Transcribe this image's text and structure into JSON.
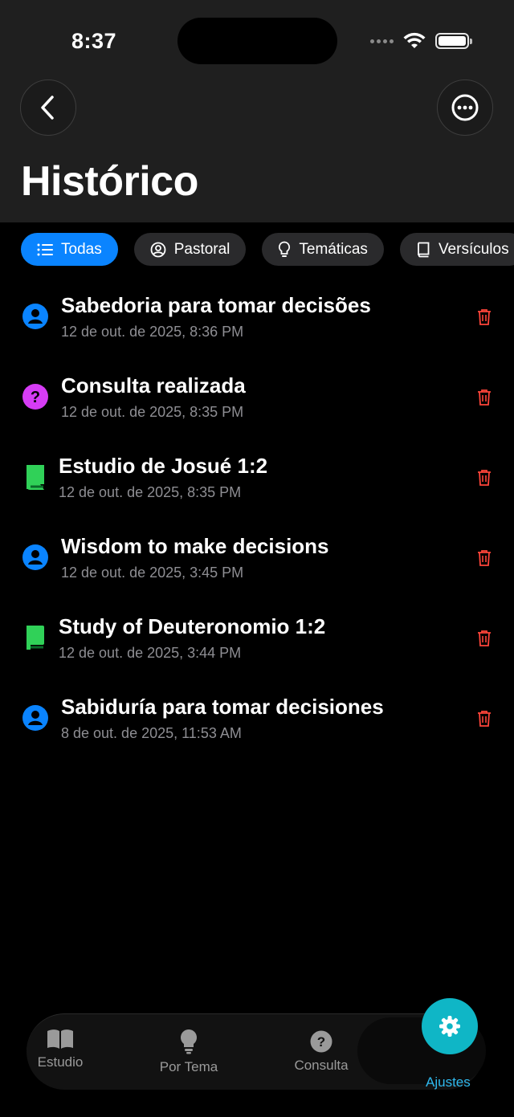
{
  "status": {
    "time": "8:37"
  },
  "header": {
    "title": "Histórico"
  },
  "filters": [
    {
      "label": "Todas",
      "icon": "list-icon",
      "active": true
    },
    {
      "label": "Pastoral",
      "icon": "person-circle-icon",
      "active": false
    },
    {
      "label": "Temáticas",
      "icon": "lightbulb-icon",
      "active": false
    },
    {
      "label": "Versículos",
      "icon": "book-icon",
      "active": false
    }
  ],
  "history": [
    {
      "title": "Sabedoria para tomar decisões",
      "date": "12 de out. de 2025, 8:36 PM",
      "type": "pastoral",
      "icon": "person-icon",
      "color": "#0a84ff"
    },
    {
      "title": "Consulta realizada",
      "date": "12 de out. de 2025, 8:35 PM",
      "type": "consulta",
      "icon": "question-icon",
      "color": "#d63cf5"
    },
    {
      "title": "Estudio de Josué 1:2",
      "date": "12 de out. de 2025, 8:35 PM",
      "type": "estudio",
      "icon": "book-icon",
      "color": "#30d158"
    },
    {
      "title": "Wisdom to make decisions",
      "date": "12 de out. de 2025, 3:45 PM",
      "type": "pastoral",
      "icon": "person-icon",
      "color": "#0a84ff"
    },
    {
      "title": "Study of Deuteronomio 1:2",
      "date": "12 de out. de 2025, 3:44 PM",
      "type": "estudio",
      "icon": "book-icon",
      "color": "#30d158"
    },
    {
      "title": "Sabiduría para tomar decisiones",
      "date": "8 de out. de 2025, 11:53 AM",
      "type": "pastoral",
      "icon": "person-icon",
      "color": "#0a84ff"
    }
  ],
  "tabbar": {
    "estudio": "Estudio",
    "tema": "Por Tema",
    "consulta": "Consulta",
    "ajustes": "Ajustes"
  },
  "colors": {
    "accent": "#0a84ff",
    "delete": "#ff453a",
    "settings": "#0fb6c6"
  }
}
